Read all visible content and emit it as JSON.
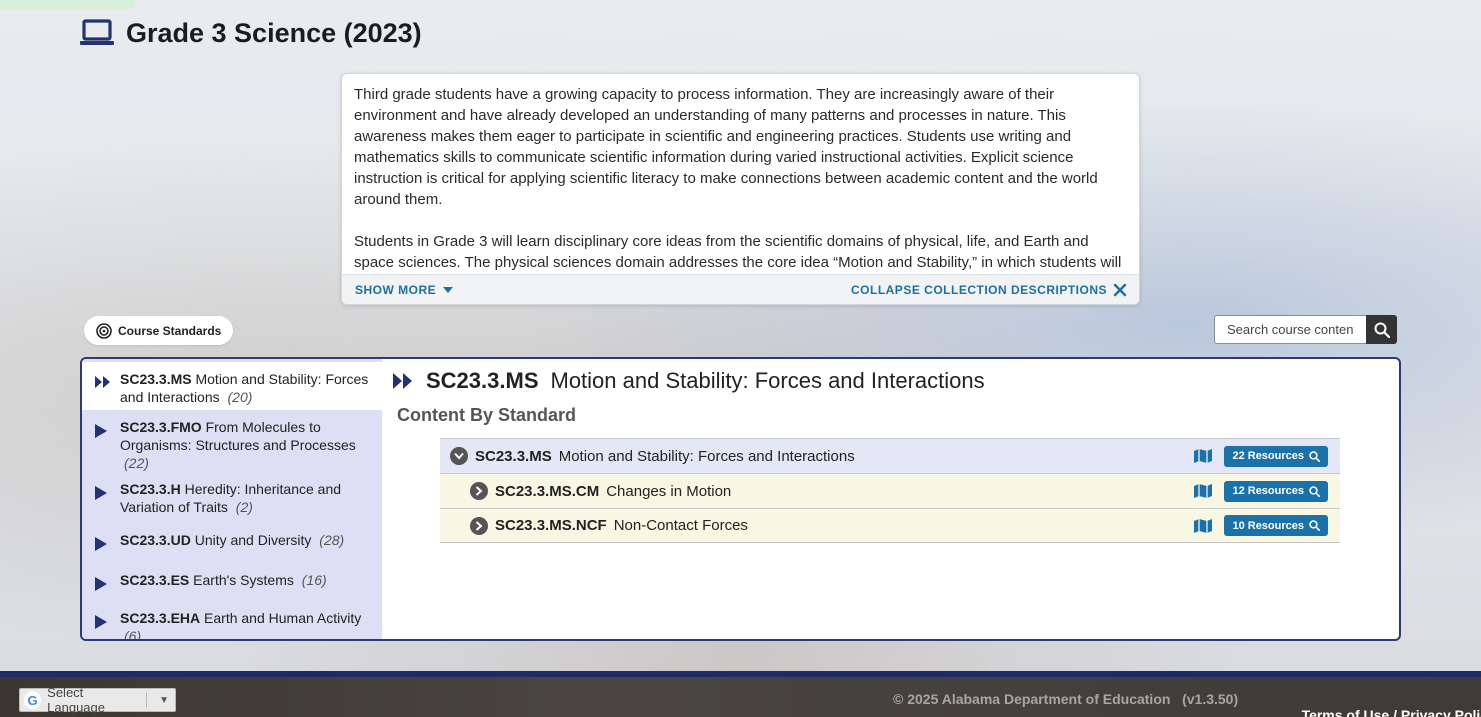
{
  "page": {
    "title": "Grade 3 Science (2023)",
    "title_icon": "laptop-icon"
  },
  "description": {
    "paragraph1": "Third grade students have a growing capacity to process information. They are increasingly aware of their environment and have already developed an understanding of many patterns and processes in nature. This awareness makes them eager to participate in scientific and engineering practices. Students use writing and mathematics skills to communicate scientific information during varied instructional activities. Explicit science instruction is critical for applying scientific literacy to make connections between academic content and the world around them.",
    "paragraph2": "Students in Grade 3 will learn disciplinary core ideas from the scientific domains of physical, life, and Earth and space sciences. The physical sciences domain addresses the core idea “Motion and Stability,” in which students will",
    "show_more": "SHOW MORE",
    "collapse": "COLLAPSE COLLECTION DESCRIPTIONS"
  },
  "course_standards": {
    "label": "Course Standards",
    "icon": "target-icon"
  },
  "search": {
    "placeholder": "Search course content"
  },
  "sidebar": {
    "items": [
      {
        "code": "SC23.3.MS",
        "label": "Motion and Stability: Forces and Interactions",
        "count": "(20)",
        "active": true
      },
      {
        "code": "SC23.3.FMO",
        "label": "From Molecules to Organisms: Structures and Processes",
        "count": "(22)",
        "active": false
      },
      {
        "code": "SC23.3.H",
        "label": "Heredity: Inheritance and Variation of Traits",
        "count": "(2)",
        "active": false
      },
      {
        "code": "SC23.3.UD",
        "label": "Unity and Diversity",
        "count": "(28)",
        "active": false
      },
      {
        "code": "SC23.3.ES",
        "label": "Earth's Systems",
        "count": "(16)",
        "active": false
      },
      {
        "code": "SC23.3.EHA",
        "label": "Earth and Human Activity",
        "count": "(6)",
        "active": false
      }
    ]
  },
  "content": {
    "code": "SC23.3.MS",
    "title": "Motion and Stability: Forces and Interactions",
    "section_heading": "Content By Standard",
    "rows": [
      {
        "code": "SC23.3.MS",
        "label": "Motion and Stability: Forces and Interactions",
        "resources": "22 Resources",
        "type": "parent"
      },
      {
        "code": "SC23.3.MS.CM",
        "label": "Changes in Motion",
        "resources": "12 Resources",
        "type": "child"
      },
      {
        "code": "SC23.3.MS.NCF",
        "label": "Non-Contact Forces",
        "resources": "10 Resources",
        "type": "child"
      }
    ]
  },
  "footer": {
    "language": "Select Language",
    "copyright": "© 2025 Alabama Department of Education   (v1.3.50)",
    "terms": "Terms of Use",
    "divider": " / ",
    "privacy": "Privacy Policy"
  },
  "colors": {
    "accent_blue": "#1a72a8",
    "navy": "#2a3a7a",
    "sidebar_bg": "#dde0f5",
    "child_row_bg": "#f8f7e3"
  }
}
